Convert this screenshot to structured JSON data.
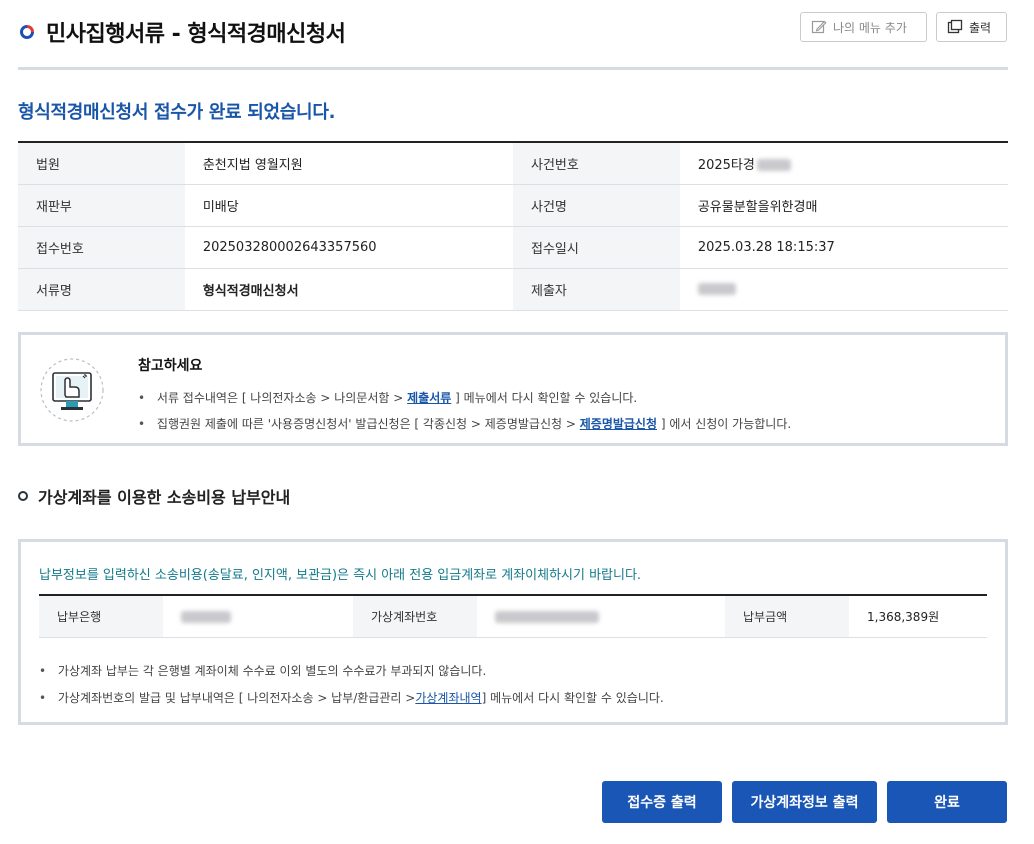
{
  "header": {
    "title": "민사집행서류 - 형식적경매신청서",
    "my_menu_label": "나의 메뉴 추가",
    "print_label": "출력"
  },
  "completion_message": "형식적경매신청서 접수가 완료 되었습니다.",
  "info": {
    "court_label": "법원",
    "court_value": "춘천지법 영월지원",
    "case_no_label": "사건번호",
    "case_no_value": "2025타경",
    "division_label": "재판부",
    "division_value": "미배당",
    "case_name_label": "사건명",
    "case_name_value": "공유물분할을위한경매",
    "receipt_no_label": "접수번호",
    "receipt_no_value": "202503280002643357560",
    "receipt_date_label": "접수일시",
    "receipt_date_value": "2025.03.28 18:15:37",
    "doc_name_label": "서류명",
    "doc_name_value": "형식적경매신청서",
    "submitter_label": "제출자"
  },
  "notice": {
    "title": "참고하세요",
    "line1_prefix": "서류 접수내역은 [ 나의전자소송 > 나의문서함 > ",
    "line1_link": "제출서류",
    "line1_suffix": " ] 메뉴에서 다시 확인할 수 있습니다.",
    "line2_prefix": "집행권원 제출에 따른 '사용증명신청서' 발급신청은 [ 각종신청 > 제증명발급신청 > ",
    "line2_link": "제증명발급신청",
    "line2_suffix": " ] 에서 신청이 가능합니다."
  },
  "payment": {
    "section_title": "가상계좌를 이용한 소송비용 납부안내",
    "message": "납부정보를 입력하신 소송비용(송달료, 인지액, 보관금)은 즉시 아래 전용 입금계좌로 계좌이체하시기 바랍니다.",
    "bank_label": "납부은행",
    "account_label": "가상계좌번호",
    "amount_label": "납부금액",
    "amount_value": "1,368,389원",
    "note1": "가상계좌 납부는 각 은행별 계좌이체 수수료 이외 별도의 수수료가 부과되지 않습니다.",
    "note2_prefix": "가상계좌번호의 발급 및 납부내역은 [ 나의전자소송 > 납부/환급관리 >",
    "note2_link": "가상계좌내역",
    "note2_suffix": "] 메뉴에서 다시 확인할 수 있습니다."
  },
  "buttons": {
    "receipt_print": "접수증 출력",
    "vaccount_print": "가상계좌정보 출력",
    "done": "완료"
  },
  "colors": {
    "primary_button": "#1a56b6",
    "title_blue": "#1a56a8",
    "message_teal": "#137a8a"
  }
}
